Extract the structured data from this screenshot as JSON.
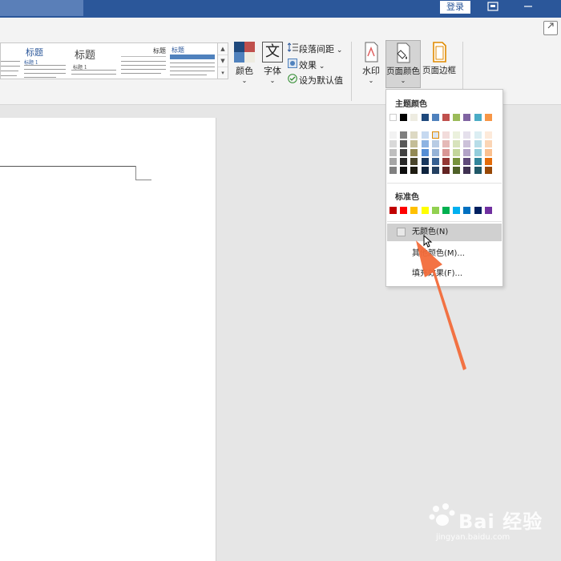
{
  "titlebar": {
    "login_label": "登录"
  },
  "ribbon": {
    "gallery": {
      "thumbs": [
        {
          "title": "标题",
          "subtitle": "标题 1"
        },
        {
          "title": "标题",
          "subtitle": "标题 1"
        },
        {
          "title": "标题",
          "subtitle": ""
        },
        {
          "title": "标题",
          "subtitle": ""
        }
      ]
    },
    "colors_label": "颜色",
    "fonts_label": "字体",
    "paragraph_spacing_label": "段落间距",
    "effects_label": "效果",
    "set_default_label": "设为默认值",
    "watermark_label": "水印",
    "page_color_label": "页面颜色",
    "page_border_label": "页面边框"
  },
  "dropdown": {
    "theme_colors_heading": "主题颜色",
    "theme_top_row": [
      "#ffffff",
      "#000000",
      "#e7e6e6",
      "#44546a",
      "#4472c4",
      "#ed7d31",
      "#a5a5a5",
      "#ffc000",
      "#5b9bd5",
      "#70ad47"
    ],
    "theme_top_row_display": [
      "#ffffff",
      "#000000",
      "#eeece1",
      "#1f497d",
      "#4f81bd",
      "#c0504d",
      "#9bbb59",
      "#8064a2",
      "#4bacc6",
      "#f79646"
    ],
    "theme_shades": [
      [
        "#f2f2f2",
        "#d9d9d9",
        "#bfbfbf",
        "#a6a6a6",
        "#808080"
      ],
      [
        "#7f7f7f",
        "#595959",
        "#404040",
        "#262626",
        "#0d0d0d"
      ],
      [
        "#ddd9c3",
        "#c4bd97",
        "#948a54",
        "#4a452a",
        "#1e1c11"
      ],
      [
        "#c6d9f0",
        "#8db3e2",
        "#548dd4",
        "#17365d",
        "#0f243e"
      ],
      [
        "#dbe5f1",
        "#b8cce4",
        "#95b3d7",
        "#366092",
        "#244061"
      ],
      [
        "#f2dcdb",
        "#e5b9b7",
        "#d99694",
        "#953734",
        "#632423"
      ],
      [
        "#ebf1dd",
        "#d7e3bc",
        "#c3d69b",
        "#76923c",
        "#4f6128"
      ],
      [
        "#e5e0ec",
        "#ccc1d9",
        "#b2a2c7",
        "#5f497a",
        "#3f3151"
      ],
      [
        "#dbeef3",
        "#b7dde8",
        "#92cddc",
        "#31859b",
        "#205867"
      ],
      [
        "#fdeada",
        "#fbd5b5",
        "#fac08f",
        "#e36c09",
        "#974806"
      ]
    ],
    "standard_colors_heading": "标准色",
    "standard_colors": [
      "#c00000",
      "#ff0000",
      "#ffc000",
      "#ffff00",
      "#92d050",
      "#00b050",
      "#00b0f0",
      "#0070c0",
      "#002060",
      "#7030a0"
    ],
    "no_color_label": "无颜色(N)",
    "more_colors_label": "其他颜色(M)...",
    "fill_effects_label": "填充效果(F)..."
  },
  "watermark": {
    "brand": "Bai 经验",
    "url": "jingyan.baidu.com"
  },
  "annotation": {
    "arrow_color": "#f26b3a"
  }
}
